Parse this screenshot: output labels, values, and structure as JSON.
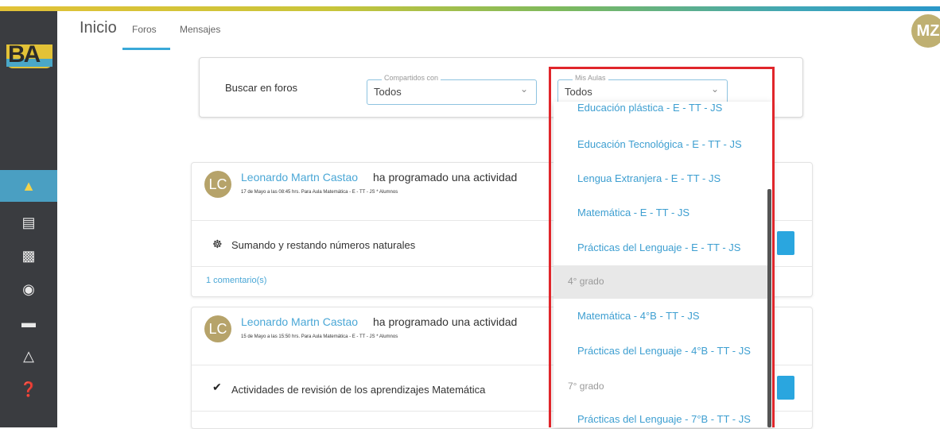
{
  "header": {
    "title": "Inicio",
    "tabs": [
      {
        "label": "Foros"
      },
      {
        "label": "Mensajes"
      }
    ],
    "user_initials": "MZ"
  },
  "logo_text": "BA",
  "sidebar": {
    "items": [
      {
        "icon": "home-icon"
      },
      {
        "icon": "calendar-icon"
      },
      {
        "icon": "notebook-icon"
      },
      {
        "icon": "storage-icon"
      },
      {
        "icon": "computer-icon"
      },
      {
        "icon": "users-icon"
      },
      {
        "icon": "help-icon"
      }
    ]
  },
  "search": {
    "label": "Buscar en foros",
    "shared": {
      "legend": "Compartidos con",
      "value": "Todos"
    },
    "classes": {
      "legend": "Mis Aulas",
      "value": "Todos"
    }
  },
  "posts": [
    {
      "initials": "LC",
      "author": "Leonardo Martn Castao",
      "action": "ha programado una actividad",
      "meta": "17 de Mayo a las 08:45 hrs. Para Aula Matemática - E - TT - JS * Alumnos",
      "activity": "Sumando y restando números naturales",
      "comments": "1 comentario(s)"
    },
    {
      "initials": "LC",
      "author": "Leonardo Martn Castao",
      "action": "ha programado una actividad",
      "meta": "15 de Mayo a las 15:50 hrs. Para Aula Matemática - E - TT - JS * Alumnos",
      "activity": "Actividades de revisión de los aprendizajes Matemática"
    }
  ],
  "dropdown": {
    "items": [
      "Educación plástica - E - TT - JS",
      "Educación Tecnológica - E - TT - JS",
      "Lengua Extranjera - E - TT - JS",
      "Matemática - E - TT - JS",
      "Prácticas del Lenguaje - E - TT - JS",
      "Matemática - 4°B - TT - JS",
      "Prácticas del Lenguaje - 4°B - TT - JS",
      "Prácticas del Lenguaje - 7°B - TT - JS"
    ],
    "groups": [
      "4° grado",
      "7° grado"
    ]
  }
}
